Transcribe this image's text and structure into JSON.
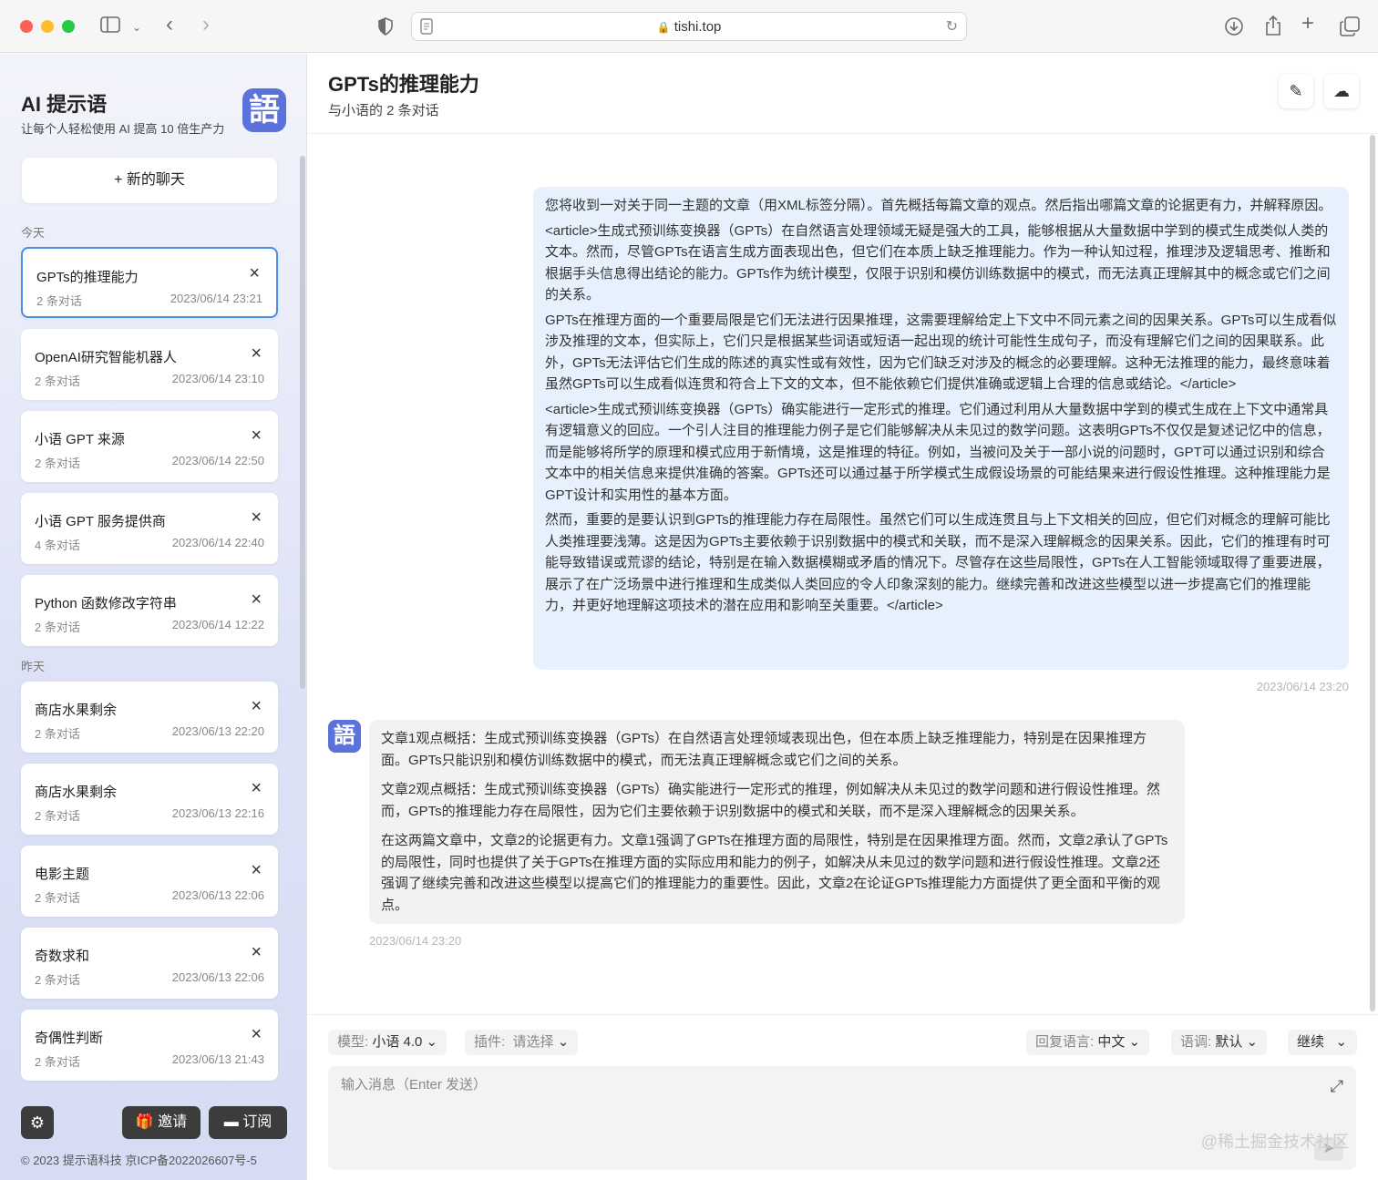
{
  "browser": {
    "url": "tishi.top",
    "icons": [
      "sidebar-icon",
      "chevron-down-icon",
      "back-icon",
      "forward-icon",
      "shield-icon",
      "page-icon",
      "lock-icon",
      "reload-icon",
      "download-icon",
      "share-icon",
      "plus-icon",
      "tabs-icon"
    ]
  },
  "sidebar": {
    "brand_title": "AI 提示语",
    "brand_subtitle": "让每个人轻松使用 AI 提高 10 倍生产力",
    "logo_glyph": "語",
    "new_chat_label": "+  新的聊天",
    "sections": [
      {
        "label": "今天",
        "items": [
          {
            "title": "GPTs的推理能力",
            "count": "2 条对话",
            "date": "2023/06/14 23:21",
            "active": true
          },
          {
            "title": "OpenAI研究智能机器人",
            "count": "2 条对话",
            "date": "2023/06/14 23:10"
          },
          {
            "title": "小语 GPT 来源",
            "count": "2 条对话",
            "date": "2023/06/14 22:50"
          },
          {
            "title": "小语 GPT 服务提供商",
            "count": "4 条对话",
            "date": "2023/06/14 22:40"
          },
          {
            "title": "Python 函数修改字符串",
            "count": "2 条对话",
            "date": "2023/06/14 12:22"
          }
        ]
      },
      {
        "label": "昨天",
        "items": [
          {
            "title": "商店水果剩余",
            "count": "2 条对话",
            "date": "2023/06/13 22:20"
          },
          {
            "title": "商店水果剩余",
            "count": "2 条对话",
            "date": "2023/06/13 22:16"
          },
          {
            "title": "电影主题",
            "count": "2 条对话",
            "date": "2023/06/13 22:06"
          },
          {
            "title": "奇数求和",
            "count": "2 条对话",
            "date": "2023/06/13 22:06"
          },
          {
            "title": "奇偶性判断",
            "count": "2 条对话",
            "date": "2023/06/13 21:43"
          }
        ]
      }
    ],
    "invite_label": "🎁 邀请",
    "subscribe_label": "▬ 订阅",
    "footer": "© 2023 提示语科技    京ICP备2022026607号-5"
  },
  "header": {
    "title": "GPTs的推理能力",
    "subtitle": "与小语的 2 条对话"
  },
  "messages": [
    {
      "role": "user",
      "time": "2023/06/14 23:20",
      "paragraphs": [
        "您将收到一对关于同一主题的文章（用XML标签分隔）。首先概括每篇文章的观点。然后指出哪篇文章的论据更有力，并解释原因。",
        "<article>生成式预训练变换器（GPTs）在自然语言处理领域无疑是强大的工具，能够根据从大量数据中学到的模式生成类似人类的文本。然而，尽管GPTs在语言生成方面表现出色，但它们在本质上缺乏推理能力。作为一种认知过程，推理涉及逻辑思考、推断和根据手头信息得出结论的能力。GPTs作为统计模型，仅限于识别和模仿训练数据中的模式，而无法真正理解其中的概念或它们之间的关系。",
        "GPTs在推理方面的一个重要局限是它们无法进行因果推理，这需要理解给定上下文中不同元素之间的因果关系。GPTs可以生成看似涉及推理的文本，但实际上，它们只是根据某些词语或短语一起出现的统计可能性生成句子，而没有理解它们之间的因果联系。此外，GPTs无法评估它们生成的陈述的真实性或有效性，因为它们缺乏对涉及的概念的必要理解。这种无法推理的能力，最终意味着虽然GPTs可以生成看似连贯和符合上下文的文本，但不能依赖它们提供准确或逻辑上合理的信息或结论。</article>",
        "<article>生成式预训练变换器（GPTs）确实能进行一定形式的推理。它们通过利用从大量数据中学到的模式生成在上下文中通常具有逻辑意义的回应。一个引人注目的推理能力例子是它们能够解决从未见过的数学问题。这表明GPTs不仅仅是复述记忆中的信息，而是能够将所学的原理和模式应用于新情境，这是推理的特征。例如，当被问及关于一部小说的问题时，GPT可以通过识别和综合文本中的相关信息来提供准确的答案。GPTs还可以通过基于所学模式生成假设场景的可能结果来进行假设性推理。这种推理能力是GPT设计和实用性的基本方面。",
        "然而，重要的是要认识到GPTs的推理能力存在局限性。虽然它们可以生成连贯且与上下文相关的回应，但它们对概念的理解可能比人类推理要浅薄。这是因为GPTs主要依赖于识别数据中的模式和关联，而不是深入理解概念的因果关系。因此，它们的推理有时可能导致错误或荒谬的结论，特别是在输入数据模糊或矛盾的情况下。尽管存在这些局限性，GPTs在人工智能领域取得了重要进展，展示了在广泛场景中进行推理和生成类似人类回应的令人印象深刻的能力。继续完善和改进这些模型以进一步提高它们的推理能力，并更好地理解这项技术的潜在应用和影响至关重要。</article>"
      ]
    },
    {
      "role": "assistant",
      "time": "2023/06/14 23:20",
      "avatar_glyph": "語",
      "paragraphs": [
        "文章1观点概括：生成式预训练变换器（GPTs）在自然语言处理领域表现出色，但在本质上缺乏推理能力，特别是在因果推理方面。GPTs只能识别和模仿训练数据中的模式，而无法真正理解概念或它们之间的关系。",
        "文章2观点概括：生成式预训练变换器（GPTs）确实能进行一定形式的推理，例如解决从未见过的数学问题和进行假设性推理。然而，GPTs的推理能力存在局限性，因为它们主要依赖于识别数据中的模式和关联，而不是深入理解概念的因果关系。",
        "在这两篇文章中，文章2的论据更有力。文章1强调了GPTs在推理方面的局限性，特别是在因果推理方面。然而，文章2承认了GPTs的局限性，同时也提供了关于GPTs在推理方面的实际应用和能力的例子，如解决从未见过的数学问题和进行假设性推理。文章2还强调了继续完善和改进这些模型以提高它们的推理能力的重要性。因此，文章2在论证GPTs推理能力方面提供了更全面和平衡的观点。"
      ]
    }
  ],
  "chatbar": {
    "model_label": "模型:",
    "model_value": "小语 4.0",
    "plugin_label": "插件:",
    "plugin_value": "请选择",
    "reply_lang_label": "回复语言:",
    "reply_lang_value": "中文",
    "tone_label": "语调:",
    "tone_value": "默认",
    "continue_label": "继续",
    "input_placeholder": "输入消息（Enter 发送）",
    "watermark": "@稀土掘金技术社区"
  }
}
